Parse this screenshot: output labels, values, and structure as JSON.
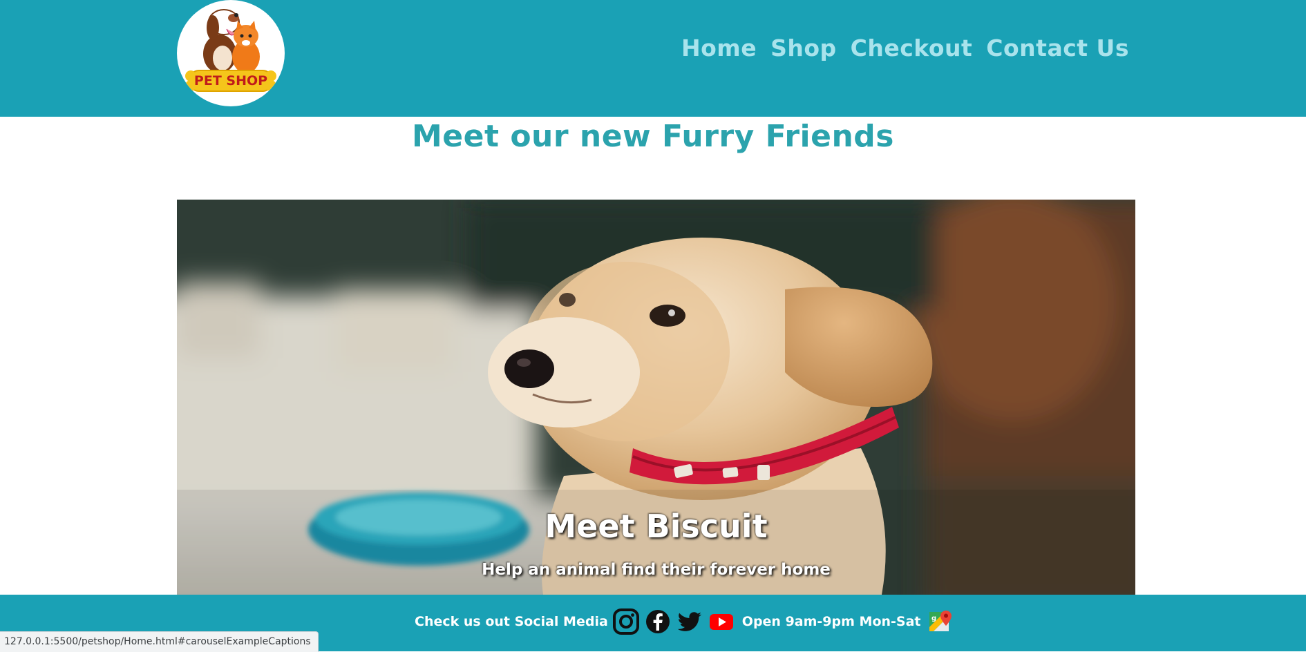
{
  "header": {
    "logo_text": "PET SHOP",
    "nav": [
      {
        "label": "Home"
      },
      {
        "label": "Shop"
      },
      {
        "label": "Checkout"
      },
      {
        "label": "Contact Us"
      }
    ]
  },
  "main": {
    "title": "Meet our new Furry Friends",
    "carousel": {
      "caption_title": "Meet Biscuit",
      "caption_subtitle": "Help an animal find their forever home"
    }
  },
  "footer": {
    "social_label": "Check us out Social Media",
    "icons": [
      "instagram-icon",
      "facebook-icon",
      "twitter-icon",
      "youtube-icon",
      "maps-icon"
    ],
    "hours": "Open 9am-9pm Mon-Sat"
  },
  "status_bar": {
    "url": "127.0.0.1:5500/petshop/Home.html#carouselExampleCaptions"
  },
  "colors": {
    "header_bg": "#1aa1b5",
    "nav_text": "#a9e3ec",
    "title_text": "#2ba3ad",
    "footer_bg": "#1aa1b5"
  }
}
